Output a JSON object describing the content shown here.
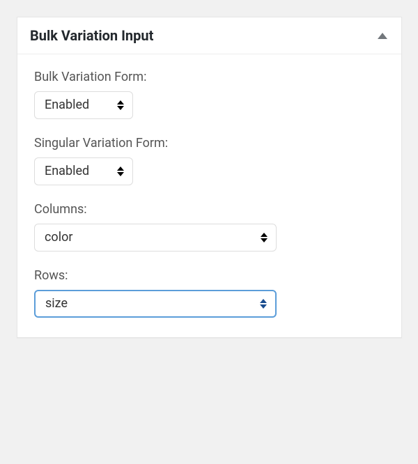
{
  "panel": {
    "title": "Bulk Variation Input"
  },
  "fields": {
    "bulk_variation_form": {
      "label": "Bulk Variation Form:",
      "value": "Enabled"
    },
    "singular_variation_form": {
      "label": "Singular Variation Form:",
      "value": "Enabled"
    },
    "columns": {
      "label": "Columns:",
      "value": "color"
    },
    "rows": {
      "label": "Rows:",
      "value": "size"
    }
  }
}
